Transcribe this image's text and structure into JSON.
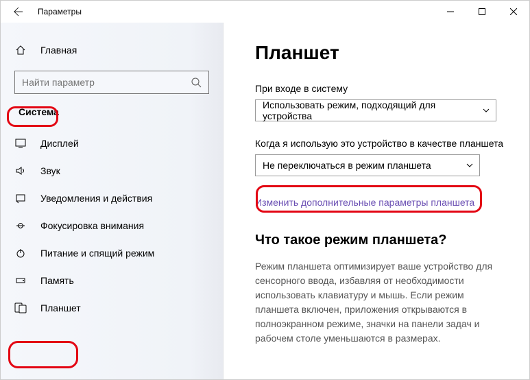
{
  "window": {
    "title": "Параметры"
  },
  "sidebar": {
    "home_label": "Главная",
    "search_placeholder": "Найти параметр",
    "category": "Система",
    "items": [
      {
        "label": "Дисплей"
      },
      {
        "label": "Звук"
      },
      {
        "label": "Уведомления и действия"
      },
      {
        "label": "Фокусировка внимания"
      },
      {
        "label": "Питание и спящий режим"
      },
      {
        "label": "Память"
      },
      {
        "label": "Планшет"
      }
    ]
  },
  "main": {
    "heading": "Планшет",
    "field1_label": "При входе в систему",
    "field1_value": "Использовать режим, подходящий для устройства",
    "field2_label": "Когда я использую это устройство в качестве планшета",
    "field2_value": "Не переключаться в режим планшета",
    "link": "Изменить дополнительные параметры планшета",
    "sub_heading": "Что такое режим планшета?",
    "description": "Режим планшета оптимизирует ваше устройство для сенсорного ввода, избавляя от необходимости использовать клавиатуру и мышь. Если режим планшета включен, приложения открываются в полноэкранном режиме, значки на панели задач и рабочем столе уменьшаются в размерах."
  }
}
